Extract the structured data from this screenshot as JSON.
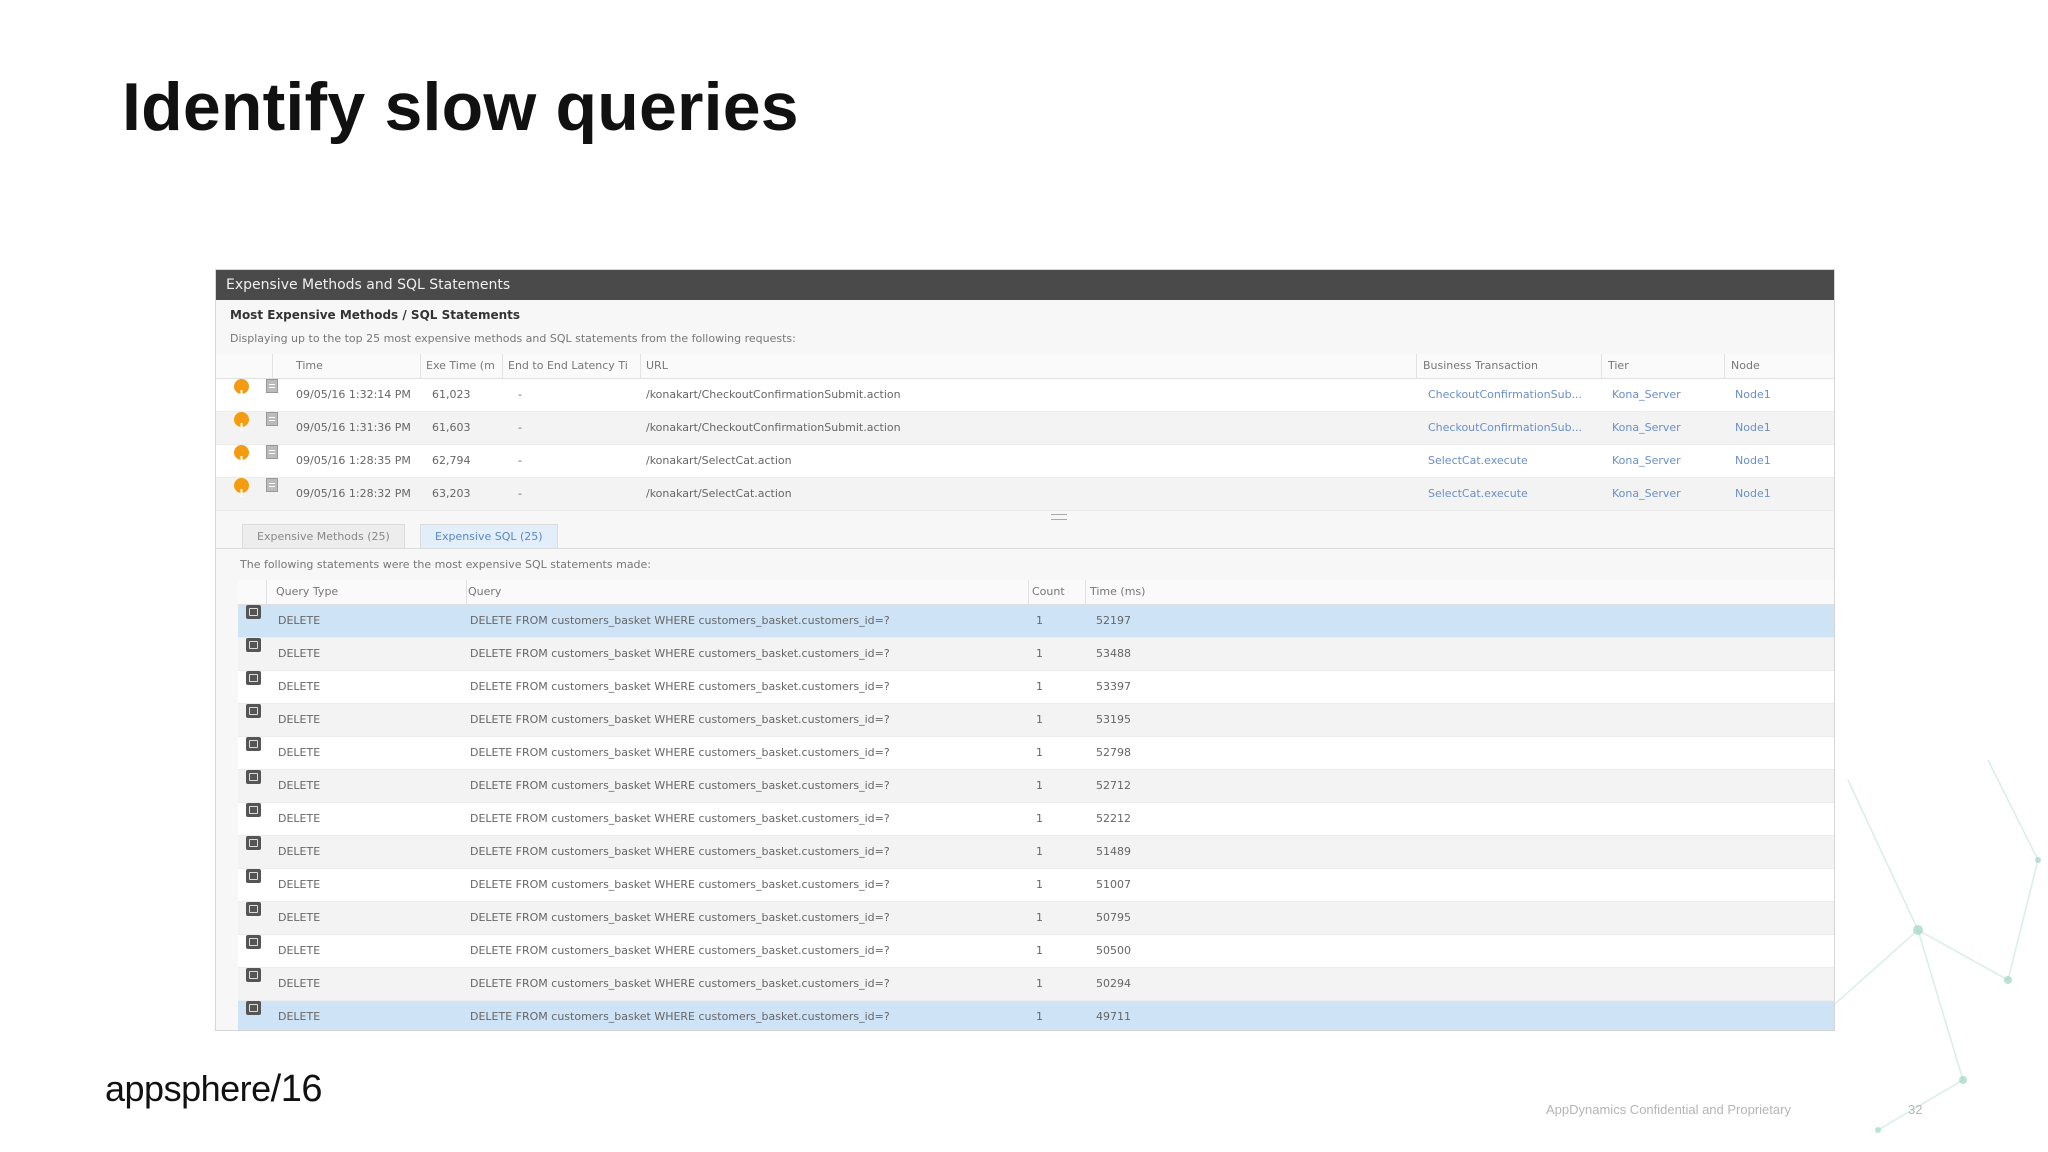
{
  "slide": {
    "title": "Identify slow queries",
    "footer": "AppDynamics Confidential and Proprietary",
    "page_number": "32",
    "logo_text": "appsphere",
    "logo_suffix": "/16"
  },
  "panel": {
    "header": "Expensive Methods and SQL Statements",
    "section_title": "Most Expensive Methods / SQL Statements",
    "section_desc": "Displaying up to the top 25 most expensive methods and SQL statements from the following requests:",
    "columns": [
      "Time",
      "Exe Time (m",
      "End to End Latency Ti",
      "URL",
      "Business Transaction",
      "Tier",
      "Node"
    ],
    "requests": [
      {
        "time": "09/05/16 1:32:14 PM",
        "exe": "61,023",
        "e2e": "-",
        "url": "/konakart/CheckoutConfirmationSubmit.action",
        "bt": "CheckoutConfirmationSub...",
        "tier": "Kona_Server",
        "node": "Node1"
      },
      {
        "time": "09/05/16 1:31:36 PM",
        "exe": "61,603",
        "e2e": "-",
        "url": "/konakart/CheckoutConfirmationSubmit.action",
        "bt": "CheckoutConfirmationSub...",
        "tier": "Kona_Server",
        "node": "Node1"
      },
      {
        "time": "09/05/16 1:28:35 PM",
        "exe": "62,794",
        "e2e": "-",
        "url": "/konakart/SelectCat.action",
        "bt": "SelectCat.execute",
        "tier": "Kona_Server",
        "node": "Node1"
      },
      {
        "time": "09/05/16 1:28:32 PM",
        "exe": "63,203",
        "e2e": "-",
        "url": "/konakart/SelectCat.action",
        "bt": "SelectCat.execute",
        "tier": "Kona_Server",
        "node": "Node1"
      }
    ]
  },
  "tabs": [
    {
      "label": "Expensive Methods (25)"
    },
    {
      "label": "Expensive SQL (25)"
    }
  ],
  "sql": {
    "desc": "The following statements were the most expensive SQL statements made:",
    "columns": [
      "Query Type",
      "Query",
      "Count",
      "Time (ms)"
    ],
    "rows": [
      {
        "type": "DELETE",
        "query": "DELETE FROM customers_basket WHERE customers_basket.customers_id=?",
        "count": "1",
        "time": "52197"
      },
      {
        "type": "DELETE",
        "query": "DELETE FROM customers_basket WHERE customers_basket.customers_id=?",
        "count": "1",
        "time": "53488"
      },
      {
        "type": "DELETE",
        "query": "DELETE FROM customers_basket WHERE customers_basket.customers_id=?",
        "count": "1",
        "time": "53397"
      },
      {
        "type": "DELETE",
        "query": "DELETE FROM customers_basket WHERE customers_basket.customers_id=?",
        "count": "1",
        "time": "53195"
      },
      {
        "type": "DELETE",
        "query": "DELETE FROM customers_basket WHERE customers_basket.customers_id=?",
        "count": "1",
        "time": "52798"
      },
      {
        "type": "DELETE",
        "query": "DELETE FROM customers_basket WHERE customers_basket.customers_id=?",
        "count": "1",
        "time": "52712"
      },
      {
        "type": "DELETE",
        "query": "DELETE FROM customers_basket WHERE customers_basket.customers_id=?",
        "count": "1",
        "time": "52212"
      },
      {
        "type": "DELETE",
        "query": "DELETE FROM customers_basket WHERE customers_basket.customers_id=?",
        "count": "1",
        "time": "51489"
      },
      {
        "type": "DELETE",
        "query": "DELETE FROM customers_basket WHERE customers_basket.customers_id=?",
        "count": "1",
        "time": "51007"
      },
      {
        "type": "DELETE",
        "query": "DELETE FROM customers_basket WHERE customers_basket.customers_id=?",
        "count": "1",
        "time": "50795"
      },
      {
        "type": "DELETE",
        "query": "DELETE FROM customers_basket WHERE customers_basket.customers_id=?",
        "count": "1",
        "time": "50500"
      },
      {
        "type": "DELETE",
        "query": "DELETE FROM customers_basket WHERE customers_basket.customers_id=?",
        "count": "1",
        "time": "50294"
      },
      {
        "type": "DELETE",
        "query": "DELETE FROM customers_basket WHERE customers_basket.customers_id=?",
        "count": "1",
        "time": "49711"
      }
    ]
  },
  "colors": {
    "header_bg": "#4a4a4a",
    "selected_row": "#cfe3f7",
    "warning": "#f39c12",
    "link": "#6a8fc8"
  },
  "icons": {
    "request_status": "warning-icon",
    "request_snapshot": "document-icon",
    "sql_row": "database-icon"
  }
}
